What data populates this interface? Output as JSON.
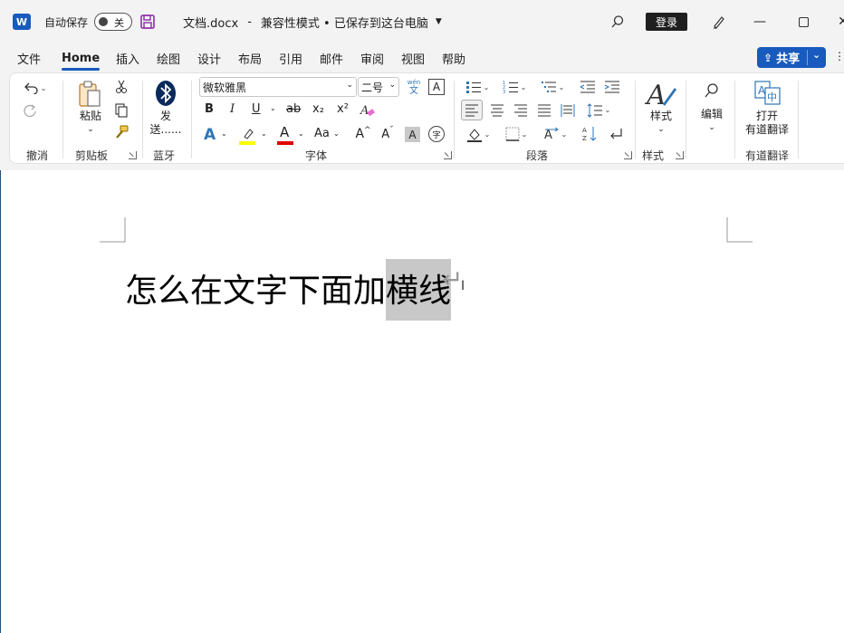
{
  "titlebar": {
    "logo_letter": "W",
    "autosave_label": "自动保存",
    "autosave_state": "关",
    "doc_name": "文档.docx",
    "separator": "-",
    "doc_status": "兼容性模式 • 已保存到这台电脑",
    "login_label": "登录"
  },
  "menu": {
    "tabs": [
      {
        "label": "文件"
      },
      {
        "label": "Home"
      },
      {
        "label": "插入"
      },
      {
        "label": "绘图"
      },
      {
        "label": "设计"
      },
      {
        "label": "布局"
      },
      {
        "label": "引用"
      },
      {
        "label": "邮件"
      },
      {
        "label": "审阅"
      },
      {
        "label": "视图"
      },
      {
        "label": "帮助"
      }
    ],
    "active_tab": "Home",
    "share_label": "共享"
  },
  "ribbon": {
    "undo_group": "撤消",
    "paste_label": "粘贴",
    "clipboard_group": "剪贴板",
    "send_label": "发送......",
    "bluetooth_group": "蓝牙",
    "font_name": "微软雅黑",
    "font_size": "二号",
    "wen_top": "wén",
    "wen_bottom": "文",
    "font_group": "字体",
    "paragraph_group": "段落",
    "styles_label": "样式",
    "styles_group": "样式",
    "edit_label": "编辑",
    "youdao_open_label": "打开",
    "youdao_translate_label": "有道翻译",
    "youdao_group": "有道翻译",
    "fmt": {
      "bold": "B",
      "italic": "I",
      "underline": "U",
      "strike": "ab",
      "subscript": "x₂",
      "superscript": "x²",
      "text_effect": "A",
      "font_color": "A",
      "change_case": "Aa",
      "grow": "A^",
      "shrink": "Aˇ",
      "char_shade": "A",
      "enclose": "字"
    },
    "colors": {
      "highlight": "#ffff00",
      "font_color": "#e00000",
      "text_effect": "#2e75b6"
    }
  },
  "document": {
    "text_before": "怎么在文字下面加",
    "text_selected": "横线",
    "paragraph_mark": "↵"
  }
}
